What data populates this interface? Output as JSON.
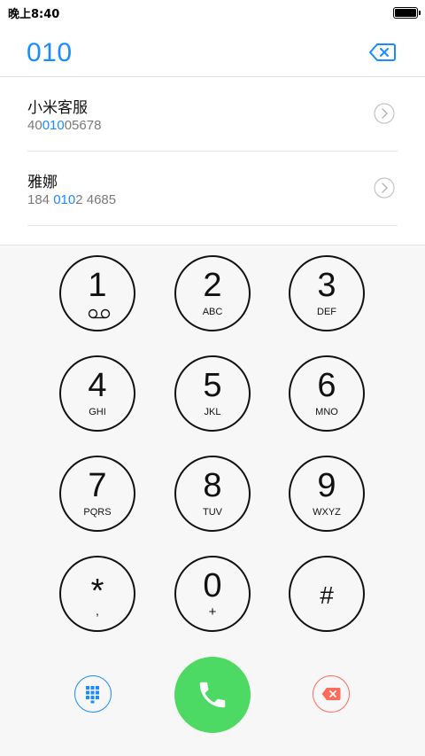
{
  "status_bar": {
    "time": "晚上8:40",
    "battery_icon": "battery-full-icon"
  },
  "dialer": {
    "dialed_number": "010",
    "delete_icon": "backspace-icon"
  },
  "results": [
    {
      "name": "小米客服",
      "number_parts": [
        "40",
        "010",
        "05678"
      ],
      "arrow_icon": "chevron-right-circle-icon"
    },
    {
      "name": "雅娜",
      "number_parts": [
        "184 ",
        "010",
        "2 4685"
      ],
      "arrow_icon": "chevron-right-circle-icon"
    }
  ],
  "keypad": {
    "keys": [
      {
        "digit": "1",
        "letters": "",
        "icon": "voicemail-icon"
      },
      {
        "digit": "2",
        "letters": "ABC"
      },
      {
        "digit": "3",
        "letters": "DEF"
      },
      {
        "digit": "4",
        "letters": "GHI"
      },
      {
        "digit": "5",
        "letters": "JKL"
      },
      {
        "digit": "6",
        "letters": "MNO"
      },
      {
        "digit": "7",
        "letters": "PQRS"
      },
      {
        "digit": "8",
        "letters": "TUV"
      },
      {
        "digit": "9",
        "letters": "WXYZ"
      },
      {
        "digit": "*",
        "letters": ","
      },
      {
        "digit": "0",
        "letters": "+"
      },
      {
        "digit": "#",
        "letters": ""
      }
    ]
  },
  "actions": {
    "keypad_toggle_icon": "keypad-grid-icon",
    "call_icon": "phone-icon",
    "delete_icon": "backspace-icon"
  },
  "colors": {
    "accent": "#1a8cff",
    "call": "#4cd964",
    "delete": "#ff6b5a"
  }
}
